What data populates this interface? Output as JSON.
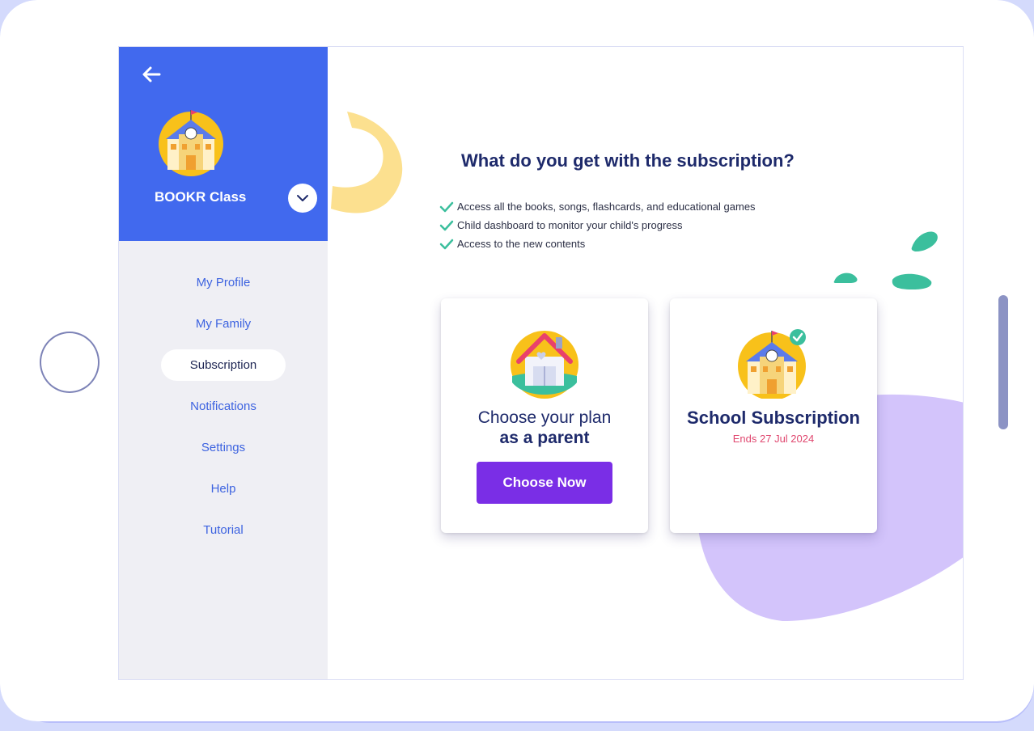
{
  "sidebar": {
    "class_name": "BOOKR Class",
    "items": [
      {
        "label": "My Profile",
        "active": false
      },
      {
        "label": "My Family",
        "active": false
      },
      {
        "label": "Subscription",
        "active": true
      },
      {
        "label": "Notifications",
        "active": false
      },
      {
        "label": "Settings",
        "active": false
      },
      {
        "label": "Help",
        "active": false
      },
      {
        "label": "Tutorial",
        "active": false
      }
    ]
  },
  "main": {
    "headline": "What do you get with the subscription?",
    "benefits": [
      "Access all the books, songs, flashcards, and educational games",
      "Child dashboard to monitor your child's progress",
      "Access to the new contents"
    ],
    "parent_card": {
      "line1": "Choose your plan",
      "line2": "as a parent",
      "button_label": "Choose Now"
    },
    "school_card": {
      "title": "School Subscription",
      "ends": "Ends 27 Jul 2024"
    }
  },
  "colors": {
    "sidebar_header": "#4169ee",
    "accent_purple": "#7a2ee6",
    "title_navy": "#1e2a6b",
    "ends_pink": "#e0476f",
    "check_teal": "#3bbf9d"
  }
}
